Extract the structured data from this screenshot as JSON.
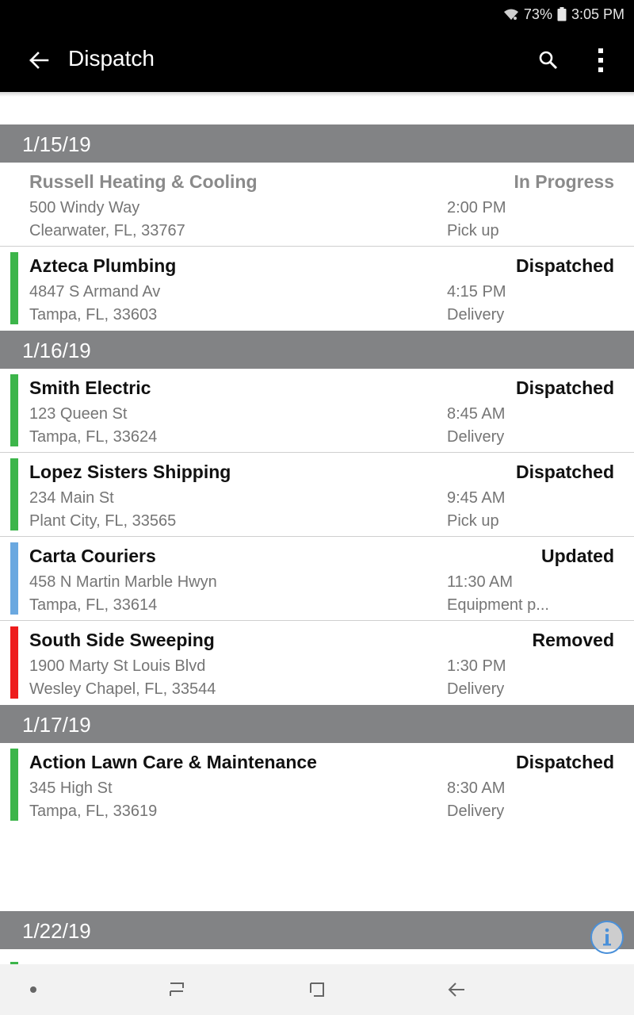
{
  "status_bar": {
    "battery_percent": "73%",
    "time": "3:05 PM"
  },
  "app_bar": {
    "title": "Dispatch"
  },
  "colors": {
    "dispatched": "#3cb54a",
    "updated": "#6aa8e0",
    "removed": "#ee1c1c",
    "header_bg": "#828385"
  },
  "groups": [
    {
      "date": "1/15/19",
      "items": [
        {
          "company": "Russell Heating & Cooling",
          "street": "500 Windy Way",
          "city": "Clearwater, FL, 33767",
          "status": "In Progress",
          "time": "2:00 PM",
          "type": "Pick up",
          "bar_color": ""
        },
        {
          "company": "Azteca Plumbing",
          "street": "4847 S Armand Av",
          "city": "Tampa, FL, 33603",
          "status": "Dispatched",
          "time": "4:15 PM",
          "type": "Delivery",
          "bar_color": "#3cb54a"
        }
      ]
    },
    {
      "date": "1/16/19",
      "items": [
        {
          "company": "Smith Electric",
          "street": "123 Queen St",
          "city": "Tampa, FL, 33624",
          "status": "Dispatched",
          "time": "8:45 AM",
          "type": "Delivery",
          "bar_color": "#3cb54a"
        },
        {
          "company": "Lopez Sisters Shipping",
          "street": "234 Main St",
          "city": "Plant City, FL, 33565",
          "status": "Dispatched",
          "time": "9:45 AM",
          "type": "Pick up",
          "bar_color": "#3cb54a"
        },
        {
          "company": "Carta Couriers",
          "street": "458 N Martin Marble Hwyn",
          "city": "Tampa, FL, 33614",
          "status": "Updated",
          "time": "11:30 AM",
          "type": "Equipment p...",
          "bar_color": "#6aa8e0"
        },
        {
          "company": "South Side Sweeping",
          "street": "1900 Marty St Louis Blvd",
          "city": "Wesley Chapel, FL, 33544",
          "status": "Removed",
          "time": "1:30 PM",
          "type": "Delivery",
          "bar_color": "#ee1c1c"
        }
      ]
    },
    {
      "date": "1/17/19",
      "items": [
        {
          "company": "Action Lawn Care & Maintenance",
          "street": "345 High St",
          "city": "Tampa, FL, 33619",
          "status": "Dispatched",
          "time": "8:30 AM",
          "type": "Delivery",
          "bar_color": "#3cb54a"
        }
      ]
    },
    {
      "date": "1/22/19",
      "items": []
    }
  ],
  "icons": {
    "back": "arrow-left-icon",
    "search": "search-icon",
    "more": "more-vertical-icon",
    "info": "info-icon",
    "nav": [
      "dot-icon",
      "recent-apps-icon",
      "home-icon",
      "back-icon"
    ]
  }
}
